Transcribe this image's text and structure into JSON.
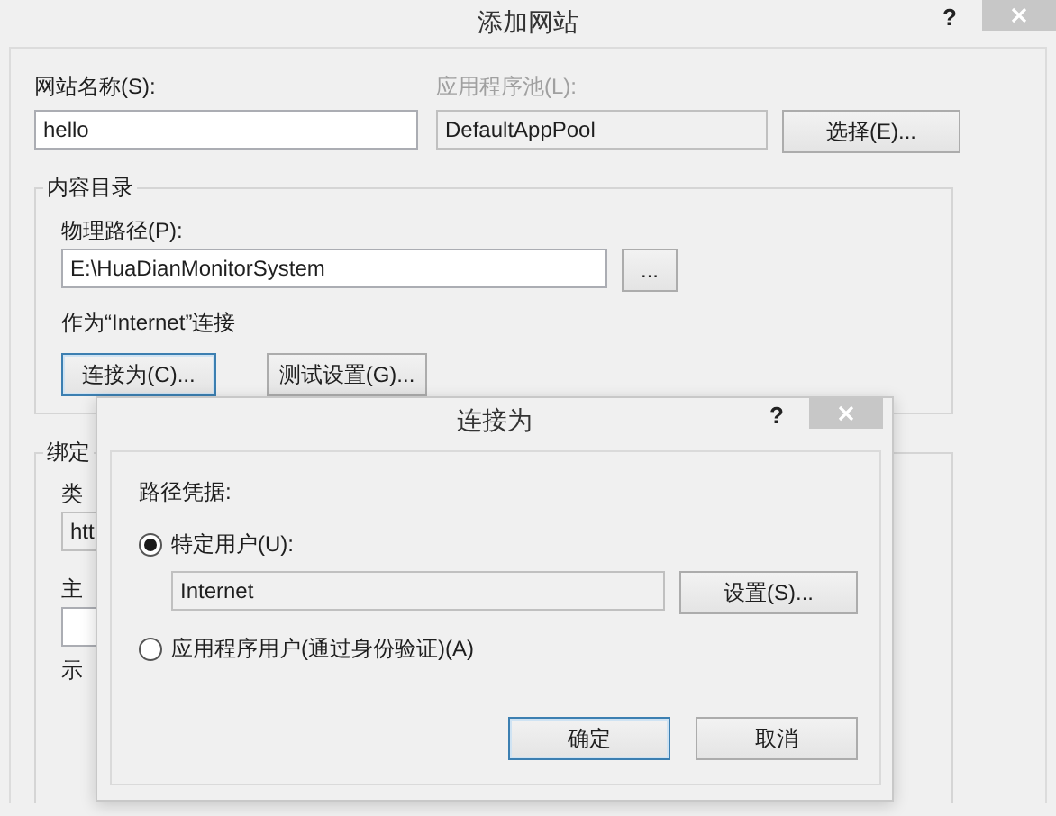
{
  "window": {
    "title": "添加网站",
    "help_glyph": "?"
  },
  "site_name": {
    "label": "网站名称(S):",
    "value": "hello"
  },
  "app_pool": {
    "label": "应用程序池(L):",
    "value": "DefaultAppPool",
    "disabled": true,
    "button": "选择(E)..."
  },
  "content_directory": {
    "title": "内容目录",
    "path_label": "物理路径(P):",
    "path_value": "E:\\HuaDianMonitorSystem",
    "browse_button": "...",
    "connect_info": "作为“Internet”连接",
    "buttons": [
      {
        "label": "连接为(C)...",
        "focused": true
      },
      {
        "label": "测试设置(G)...",
        "focused": false
      }
    ]
  },
  "binding": {
    "title": "绑定",
    "type_label": "类",
    "type_value": "htt",
    "host_label": "主",
    "example_label": "示"
  },
  "connect_dialog": {
    "title": "连接为",
    "help_glyph": "?",
    "credentials_label": "路径凭据:",
    "options": [
      {
        "label": "特定用户(U):",
        "selected": true
      },
      {
        "label": "应用程序用户(通过身份验证)(A)",
        "selected": false
      }
    ],
    "user_field": {
      "value": "Internet",
      "readonly": true
    },
    "set_button": "设置(S)...",
    "buttons": [
      {
        "label": "确定",
        "focused": true
      },
      {
        "label": "取消",
        "focused": false
      }
    ]
  }
}
